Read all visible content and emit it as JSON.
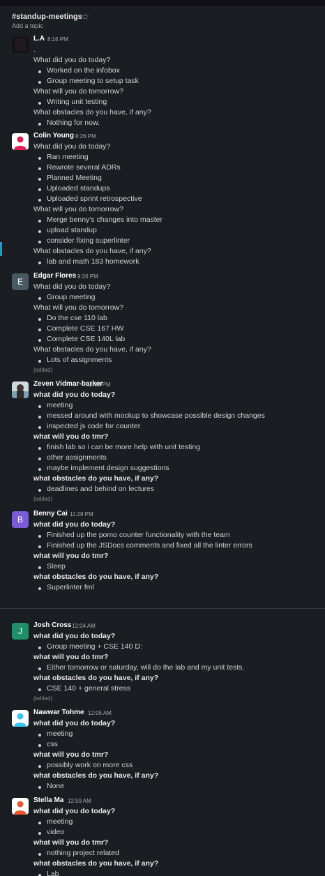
{
  "channel": {
    "name": "#standup-meetings",
    "topic": "Add a topic"
  },
  "messages": [
    {
      "author": "L.A",
      "time": "8:16 PM",
      "lines": [
        {
          "t": "text",
          "v": "."
        },
        {
          "t": "q",
          "v": "What did you do today?"
        },
        {
          "t": "b",
          "v": "Worked on the infobox"
        },
        {
          "t": "b",
          "v": "Group meeting to setup task"
        },
        {
          "t": "q",
          "v": "What will you do tomorrow?"
        },
        {
          "t": "b",
          "v": "Writing unit testing"
        },
        {
          "t": "q",
          "v": "What obstacles do you have, if any?"
        },
        {
          "t": "b",
          "v": "Nothing for now."
        }
      ]
    },
    {
      "author": "Colin Young",
      "time": "8:26 PM",
      "lines": [
        {
          "t": "q",
          "v": "What did you do today?"
        },
        {
          "t": "b",
          "v": "Ran meeting"
        },
        {
          "t": "b",
          "v": "Rewrote several ADRs"
        },
        {
          "t": "b",
          "v": "Planned Meeting"
        },
        {
          "t": "b",
          "v": "Uploaded standups"
        },
        {
          "t": "b",
          "v": "Uploaded sprint retrospective"
        },
        {
          "t": "q",
          "v": "What will you do tomorrow?"
        },
        {
          "t": "b",
          "v": "Merge benny's changes into master"
        },
        {
          "t": "b",
          "v": "upload standup"
        },
        {
          "t": "b",
          "v": "consider fixing superlinter"
        },
        {
          "t": "q",
          "v": "What obstacles do you have, if any?"
        },
        {
          "t": "b",
          "v": "lab and math 183 homework"
        }
      ]
    },
    {
      "author": "Edgar Flores",
      "time": "9:26 PM",
      "avatar_letter": "E",
      "lines": [
        {
          "t": "q",
          "v": "What did you do today?"
        },
        {
          "t": "b",
          "v": "Group meeting"
        },
        {
          "t": "q",
          "v": "What will you do tomorrow?"
        },
        {
          "t": "b",
          "v": "Do the cse 110 lab"
        },
        {
          "t": "b",
          "v": "Complete CSE 167 HW"
        },
        {
          "t": "b",
          "v": "Complete CSE 140L lab"
        },
        {
          "t": "q",
          "v": "What obstacles do you have, if any?"
        },
        {
          "t": "b",
          "v": "Lots of assignments"
        },
        {
          "t": "edited",
          "v": "(edited)"
        }
      ]
    },
    {
      "author": "Zeven Vidmar-barker",
      "time": "11:18 PM",
      "lines": [
        {
          "t": "qb",
          "v": "what did you do today?"
        },
        {
          "t": "b",
          "v": "meeting"
        },
        {
          "t": "b",
          "v": "messed around with mockup to showcase possible design changes"
        },
        {
          "t": "b",
          "v": "inspected js code for counter"
        },
        {
          "t": "qb",
          "v": "what will you do tmr?"
        },
        {
          "t": "b",
          "v": "finish lab so i can be more help with unit testing"
        },
        {
          "t": "b",
          "v": "other assignments"
        },
        {
          "t": "b",
          "v": "maybe implement design suggestions"
        },
        {
          "t": "qb",
          "v": "what obstacles do you have, if any?"
        },
        {
          "t": "b",
          "v": "deadlines and behind on lectures"
        },
        {
          "t": "edited",
          "v": "(edited)"
        }
      ]
    },
    {
      "author": "Benny Cai",
      "time": "11:28 PM",
      "avatar_letter": "B",
      "lines": [
        {
          "t": "qb",
          "v": "what did you do today?"
        },
        {
          "t": "b",
          "v": "Finished up the pomo counter functionality with the team"
        },
        {
          "t": "b",
          "v": "Finished up the JSDocs comments and fixed all the linter errors"
        },
        {
          "t": "qb",
          "v": "what will you do tmr?"
        },
        {
          "t": "b",
          "v": "Sleep"
        },
        {
          "t": "qb",
          "v": "what obstacles do you have, if any?"
        },
        {
          "t": "b",
          "v": "Superlinter fml"
        }
      ]
    },
    {
      "author": "Josh Cross",
      "time": "12:04 AM",
      "avatar_letter": "J",
      "lines": [
        {
          "t": "qb",
          "v": "what did you do today?"
        },
        {
          "t": "b",
          "v": "Group meeting + CSE 140 D:"
        },
        {
          "t": "qb",
          "v": "what will you do tmr?"
        },
        {
          "t": "b",
          "v": "Either tomorrow or saturday, will do the lab and my unit tests."
        },
        {
          "t": "qb",
          "v": "what obstacles do you have, if any?"
        },
        {
          "t": "b",
          "v": "CSE 140 + general stress"
        },
        {
          "t": "edited",
          "v": "(edited)"
        }
      ]
    },
    {
      "author": "Nawwar Tohme",
      "time": "12:05 AM",
      "lines": [
        {
          "t": "qb",
          "v": "what did you do today?"
        },
        {
          "t": "b",
          "v": "meeting"
        },
        {
          "t": "b",
          "v": "css"
        },
        {
          "t": "qb",
          "v": "what will you do tmr?"
        },
        {
          "t": "b",
          "v": "possibly work on more css"
        },
        {
          "t": "qb",
          "v": "what obstacles do you have, if any?"
        },
        {
          "t": "b",
          "v": "None"
        }
      ]
    },
    {
      "author": "Stella Ma",
      "time": "12:59 AM",
      "lines": [
        {
          "t": "qb",
          "v": "what did you do today?"
        },
        {
          "t": "b",
          "v": "meeting"
        },
        {
          "t": "b",
          "v": "video"
        },
        {
          "t": "qb",
          "v": "what will you do tmr?"
        },
        {
          "t": "b",
          "v": "nothing project related"
        },
        {
          "t": "qb",
          "v": "what obstacles do you have, if any?"
        },
        {
          "t": "b",
          "v": "Lab"
        }
      ]
    }
  ],
  "colors": {
    "background": "#1a1d21",
    "text": "#d1d2d3",
    "muted": "#ababad",
    "accent": "#1d9bd1"
  }
}
